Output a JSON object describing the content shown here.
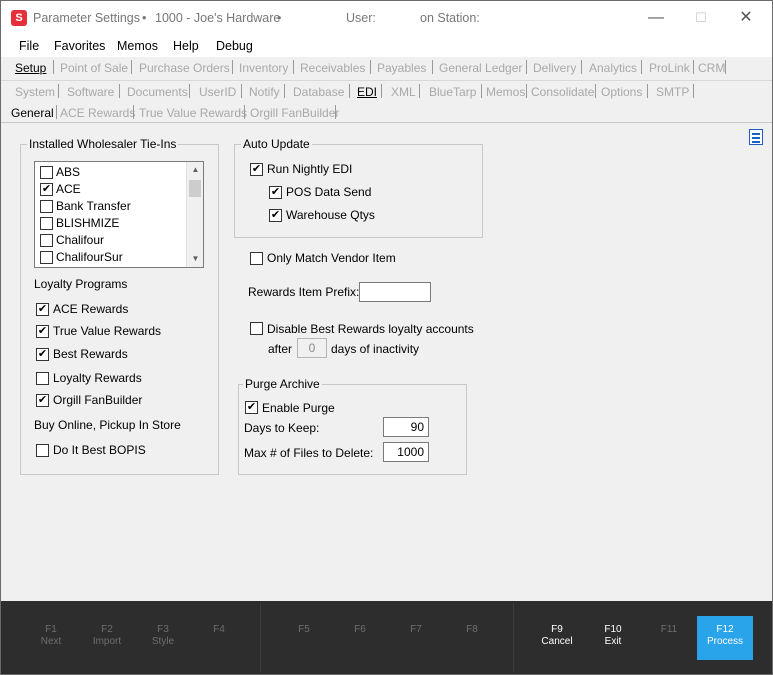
{
  "window": {
    "app_icon": "S",
    "title": "Parameter Settings",
    "title_bullet": "•",
    "company": "1000 - Joe's Hardware",
    "user_label": "User:",
    "station_label": "on Station:",
    "minimize_glyph": "—",
    "maximize_glyph": "☐",
    "close_glyph": "✕"
  },
  "menubar": [
    "File",
    "Favorites",
    "Memos",
    "Help",
    "Debug"
  ],
  "tabs_row1": [
    "Setup",
    "Point of Sale",
    "Purchase Orders",
    "Inventory",
    "Receivables",
    "Payables",
    "General Ledger",
    "Delivery",
    "Analytics",
    "ProLink",
    "CRM"
  ],
  "tabs_row2": [
    "System",
    "Software",
    "Documents",
    "UserID",
    "Notify",
    "Database",
    "EDI",
    "XML",
    "BlueTarp",
    "Memos",
    "Consolidate",
    "Options",
    "SMTP"
  ],
  "tabs_row3": [
    "General",
    "ACE Rewards",
    "True Value Rewards",
    "Orgill FanBuilder"
  ],
  "active_tabs": {
    "row1": "Setup",
    "row2": "EDI",
    "row3": "General"
  },
  "wholesaler": {
    "title": "Installed Wholesaler Tie-Ins",
    "items": [
      {
        "label": "ABS",
        "checked": false
      },
      {
        "label": "ACE",
        "checked": true
      },
      {
        "label": "Bank Transfer",
        "checked": false
      },
      {
        "label": "BLISHMIZE",
        "checked": false
      },
      {
        "label": "Chalifour",
        "checked": false
      },
      {
        "label": "ChalifourSur",
        "checked": false
      }
    ],
    "scroll_up": "▲",
    "scroll_down": "▼"
  },
  "loyalty": {
    "heading": "Loyalty Programs",
    "items": [
      {
        "label": "ACE Rewards",
        "checked": true
      },
      {
        "label": "True Value Rewards",
        "checked": true
      },
      {
        "label": "Best Rewards",
        "checked": true
      },
      {
        "label": "Loyalty Rewards",
        "checked": false
      },
      {
        "label": "Orgill FanBuilder",
        "checked": true
      }
    ]
  },
  "bopis": {
    "heading": "Buy Online, Pickup In Store",
    "items": [
      {
        "label": "Do It Best BOPIS",
        "checked": false
      }
    ]
  },
  "auto_update": {
    "title": "Auto Update",
    "run_nightly": {
      "label": "Run Nightly EDI",
      "checked": true
    },
    "pos_data": {
      "label": "POS Data Send",
      "checked": true
    },
    "warehouse": {
      "label": "Warehouse Qtys",
      "checked": true
    }
  },
  "only_match": {
    "label": "Only Match Vendor Item",
    "checked": false
  },
  "rewards_prefix": {
    "label": "Rewards Item Prefix:",
    "value": ""
  },
  "disable_best": {
    "label": "Disable Best Rewards loyalty accounts",
    "checked": false,
    "after_label": "after",
    "days_value": "0",
    "days_suffix": "days of inactivity"
  },
  "purge": {
    "title": "Purge Archive",
    "enable": {
      "label": "Enable Purge",
      "checked": true
    },
    "days_label": "Days to Keep:",
    "days_value": "90",
    "max_label": "Max # of Files to Delete:",
    "max_value": "1000"
  },
  "check_glyph": "✔",
  "fkeys": [
    {
      "key": "F1",
      "label": "Next",
      "enabled": false
    },
    {
      "key": "F2",
      "label": "Import",
      "enabled": false
    },
    {
      "key": "F3",
      "label": "Style",
      "enabled": false
    },
    {
      "key": "F4",
      "label": "",
      "enabled": false
    },
    {
      "key": "F5",
      "label": "",
      "enabled": false
    },
    {
      "key": "F6",
      "label": "",
      "enabled": false
    },
    {
      "key": "F7",
      "label": "",
      "enabled": false
    },
    {
      "key": "F8",
      "label": "",
      "enabled": false
    },
    {
      "key": "F9",
      "label": "Cancel",
      "enabled": true
    },
    {
      "key": "F10",
      "label": "Exit",
      "enabled": true
    },
    {
      "key": "F11",
      "label": "",
      "enabled": false
    },
    {
      "key": "F12",
      "label": "Process",
      "enabled": true,
      "highlight": true
    }
  ],
  "colors": {
    "accent": "#29a3ea",
    "brand": "#e5303a",
    "fbar": "#2d2d2d"
  }
}
